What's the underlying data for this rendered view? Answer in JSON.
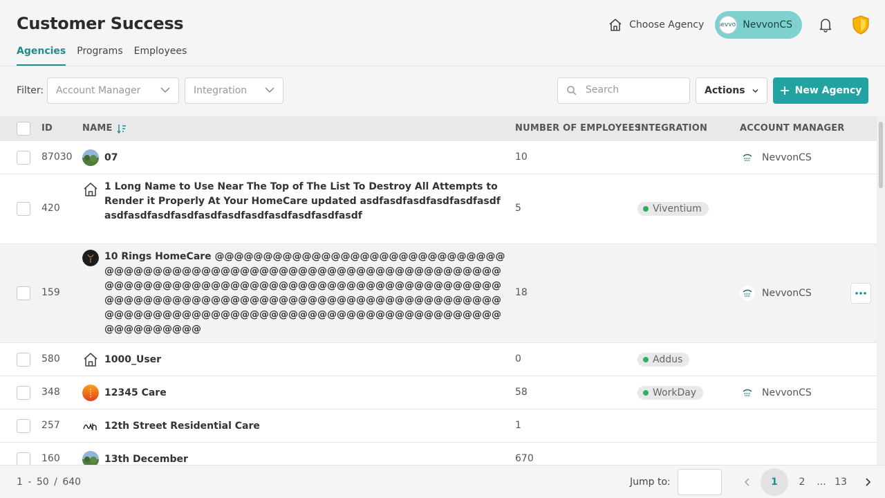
{
  "header": {
    "title": "Customer Success",
    "tabs": [
      {
        "label": "Agencies",
        "active": true
      },
      {
        "label": "Programs",
        "active": false
      },
      {
        "label": "Employees",
        "active": false
      }
    ],
    "choose_agency": "Choose Agency",
    "user": {
      "name": "NevvonCS",
      "avatar_text": "nevvon"
    }
  },
  "filters": {
    "label": "Filter:",
    "account_manager_placeholder": "Account Manager",
    "integration_placeholder": "Integration"
  },
  "search": {
    "placeholder": "Search"
  },
  "actions_label": "Actions",
  "new_agency_label": "New Agency",
  "table": {
    "columns": {
      "id": "ID",
      "name": "NAME",
      "employees": "NUMBER OF EMPLOYEES",
      "integration": "INTEGRATION",
      "manager": "ACCOUNT MANAGER"
    },
    "rows": [
      {
        "id": "87030",
        "name": "07",
        "employees": "10",
        "integration": "",
        "manager": "NevvonCS",
        "icon": "landscape-avatar"
      },
      {
        "id": "420",
        "name": "1 Long Name to Use Near The Top of The List To Destroy All Attempts to Render it Properly At Your HomeCare updated asdfasdfasdfasdfasdfasdfasdfasdfasdfasdfasdfasdfasdfasdfasdfasdfasdf",
        "employees": "5",
        "integration": "Viventium",
        "manager": "",
        "icon": "home-icon"
      },
      {
        "id": "159",
        "name": "10 Rings HomeCare @@@@@@@@@@@@@@@@@@@@@@@@@@@@@@@@@@@@@@@@@@@@@@@@@@@@@@@@@@@@@@@@@@@@@@@@@@@@@@@@@@@@@@@@@@@@@@@@@@@@@@@@@@@@@@@@@@@@@@@@@@@@@@@@@@@@@@@@@@@@@@@@@@@@@@@@@@@@@@@@@@@@@@@@@@@@@@@@@@@@@@@@@@@@@@@@@@@@@@@@@@@@",
        "employees": "18",
        "integration": "",
        "manager": "NevvonCS",
        "icon": "dark-avatar"
      },
      {
        "id": "580",
        "name": "1000_User",
        "employees": "0",
        "integration": "Addus",
        "manager": "",
        "icon": "home-icon"
      },
      {
        "id": "348",
        "name": "12345 Care",
        "employees": "58",
        "integration": "WorkDay",
        "manager": "NevvonCS",
        "icon": "sunset-avatar"
      },
      {
        "id": "257",
        "name": "12th Street Residential Care",
        "employees": "1",
        "integration": "",
        "manager": "",
        "icon": "signature-avatar"
      },
      {
        "id": "160",
        "name": "13th December",
        "employees": "670",
        "integration": "",
        "manager": "",
        "icon": "landscape-avatar"
      }
    ]
  },
  "footer": {
    "range_start": "1",
    "range_end": "50",
    "total": "640",
    "jump_label": "Jump to:",
    "pages": [
      "1",
      "2",
      "...",
      "13"
    ],
    "current_page": "1"
  },
  "colors": {
    "accent": "#22a2a0",
    "pill": "#7fd1cf",
    "status_dot": "#2fae5b"
  }
}
